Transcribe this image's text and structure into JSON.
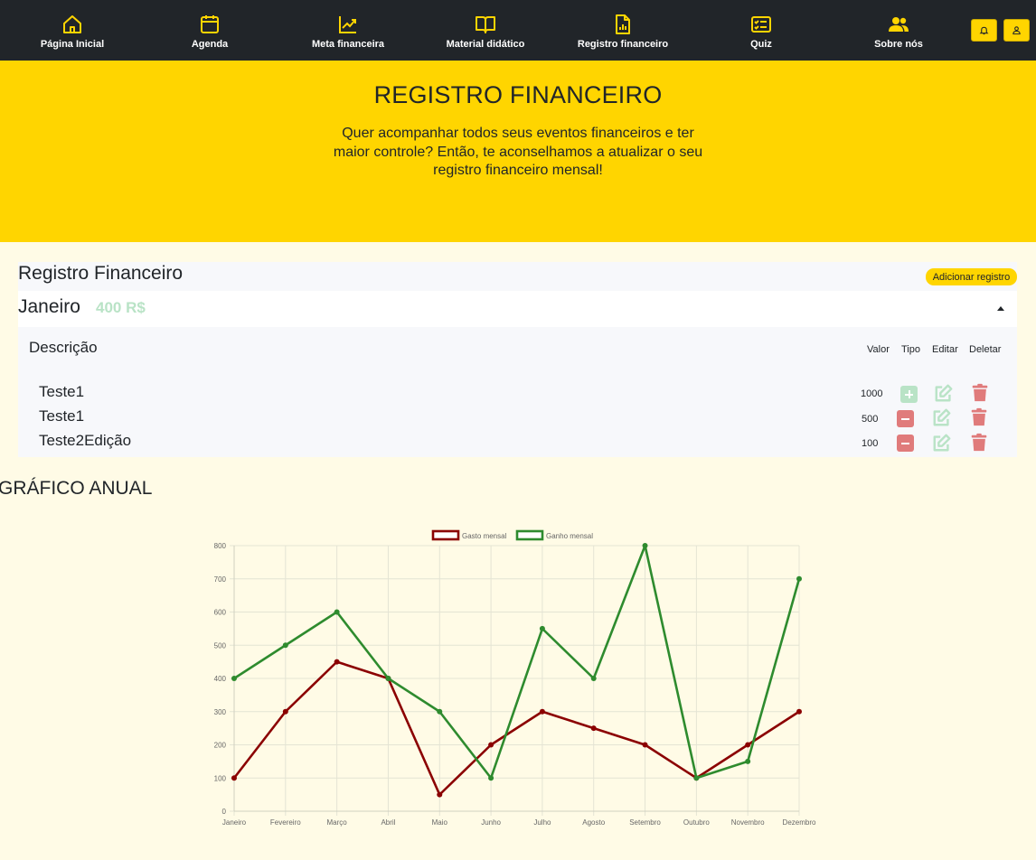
{
  "nav": {
    "items": [
      {
        "label": "Página Inicial",
        "icon": "home-icon"
      },
      {
        "label": "Agenda",
        "icon": "calendar-icon"
      },
      {
        "label": "Meta financeira",
        "icon": "chart-line-icon"
      },
      {
        "label": "Material didático",
        "icon": "book-icon"
      },
      {
        "label": "Registro financeiro",
        "icon": "report-icon"
      },
      {
        "label": "Quiz",
        "icon": "checklist-icon"
      },
      {
        "label": "Sobre nós",
        "icon": "users-icon"
      }
    ],
    "accent": "#ffd500",
    "background": "#212529"
  },
  "hero": {
    "title": "REGISTRO FINANCEIRO",
    "text": "Quer acompanhar todos seus eventos financeiros e ter maior controle? Então, te aconselhamos a atualizar o seu registro financeiro mensal!"
  },
  "registry": {
    "title": "Registro Financeiro",
    "add_label": "Adicionar registro",
    "month": "Janeiro",
    "month_total": "400 R$",
    "columns": {
      "desc": "Descrição",
      "value": "Valor",
      "type": "Tipo",
      "edit": "Editar",
      "delete": "Deletar"
    },
    "rows": [
      {
        "desc": "Teste1",
        "value": "1000",
        "type": "ganho"
      },
      {
        "desc": "Teste1",
        "value": "500",
        "type": "gasto"
      },
      {
        "desc": "Teste2Edição",
        "value": "100",
        "type": "gasto"
      }
    ],
    "colors": {
      "gain": "#b9e3c6",
      "expense": "#e07b7b"
    }
  },
  "chart_title": "GRÁFICO ANUAL",
  "chart_data": {
    "type": "line",
    "categories": [
      "Janeiro",
      "Fevereiro",
      "Março",
      "Abril",
      "Maio",
      "Junho",
      "Julho",
      "Agosto",
      "Setembro",
      "Outubro",
      "Novembro",
      "Dezembro"
    ],
    "series": [
      {
        "name": "Gasto mensal",
        "color": "#8b0000",
        "values": [
          100,
          300,
          450,
          400,
          50,
          200,
          300,
          250,
          200,
          100,
          200,
          300
        ]
      },
      {
        "name": "Ganho mensal",
        "color": "#2e8b2e",
        "values": [
          400,
          500,
          600,
          400,
          300,
          100,
          550,
          400,
          800,
          100,
          150,
          700
        ]
      }
    ],
    "ylim": [
      0,
      800
    ],
    "yticks": [
      0,
      100,
      200,
      300,
      400,
      500,
      600,
      700,
      800
    ],
    "grid": true,
    "legend": "top-center"
  }
}
